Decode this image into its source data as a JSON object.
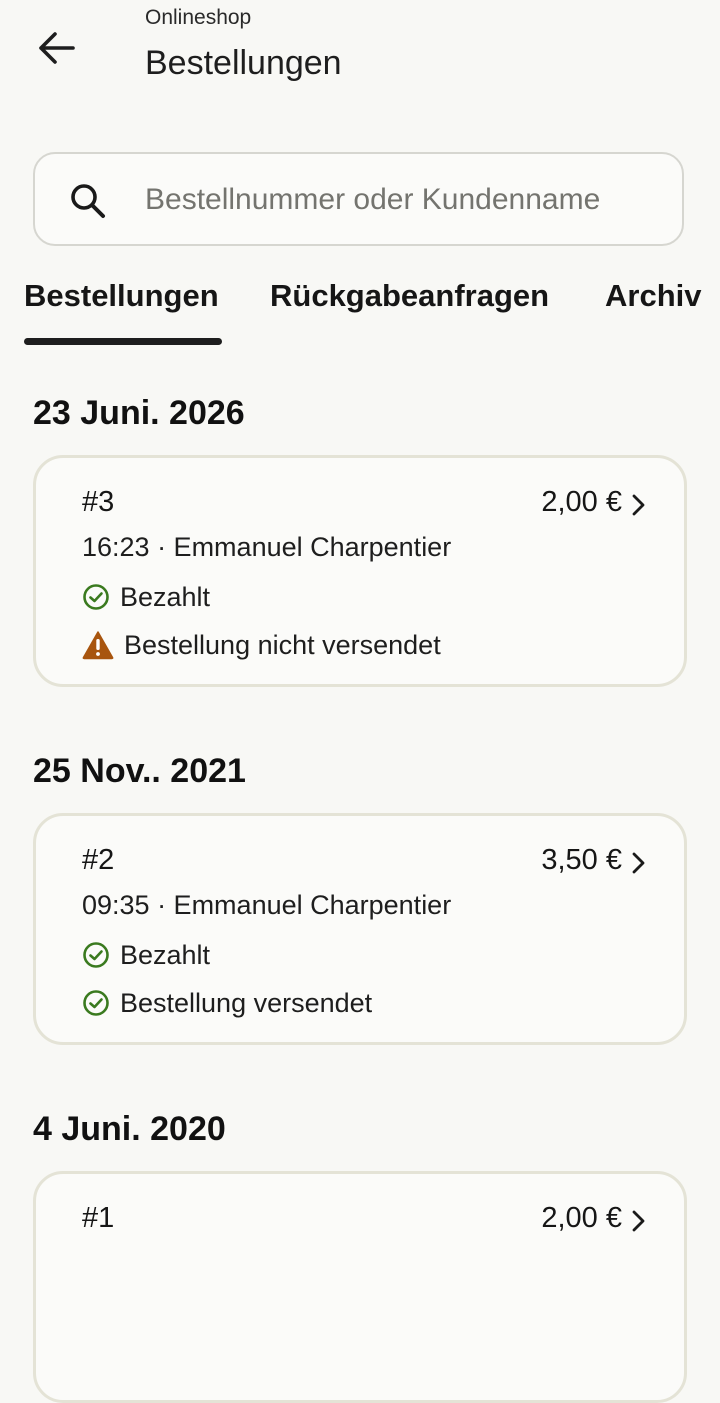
{
  "header": {
    "subtitle": "Onlineshop",
    "title": "Bestellungen"
  },
  "search": {
    "placeholder": "Bestellnummer oder Kundenname",
    "value": ""
  },
  "tabs": [
    {
      "label": "Bestellungen",
      "active": true
    },
    {
      "label": "Rückgabeanfragen",
      "active": false
    },
    {
      "label": "Archiv",
      "active": false
    }
  ],
  "groups": [
    {
      "date": "23 Juni. 2026",
      "orders": [
        {
          "number": "#3",
          "price": "2,00 €",
          "meta": "16:23 · Emmanuel Charpentier",
          "statuses": [
            {
              "label": "Bezahlt",
              "icon": "check-circle-icon",
              "color": "#3a7a1f"
            },
            {
              "label": "Bestellung nicht versendet",
              "icon": "warning-icon",
              "color": "#a8550f"
            }
          ]
        }
      ]
    },
    {
      "date": "25 Nov.. 2021",
      "orders": [
        {
          "number": "#2",
          "price": "3,50 €",
          "meta": "09:35 · Emmanuel Charpentier",
          "statuses": [
            {
              "label": "Bezahlt",
              "icon": "check-circle-icon",
              "color": "#3a7a1f"
            },
            {
              "label": "Bestellung versendet",
              "icon": "check-circle-icon",
              "color": "#3a7a1f"
            }
          ]
        }
      ]
    },
    {
      "date": "4 Juni. 2020",
      "orders": [
        {
          "number": "#1",
          "price": "2,00 €"
        }
      ]
    }
  ],
  "colors": {
    "background": "#f8f8f5",
    "card_border": "#e4e3d6",
    "success": "#3a7a1f",
    "warning": "#a8550f"
  }
}
